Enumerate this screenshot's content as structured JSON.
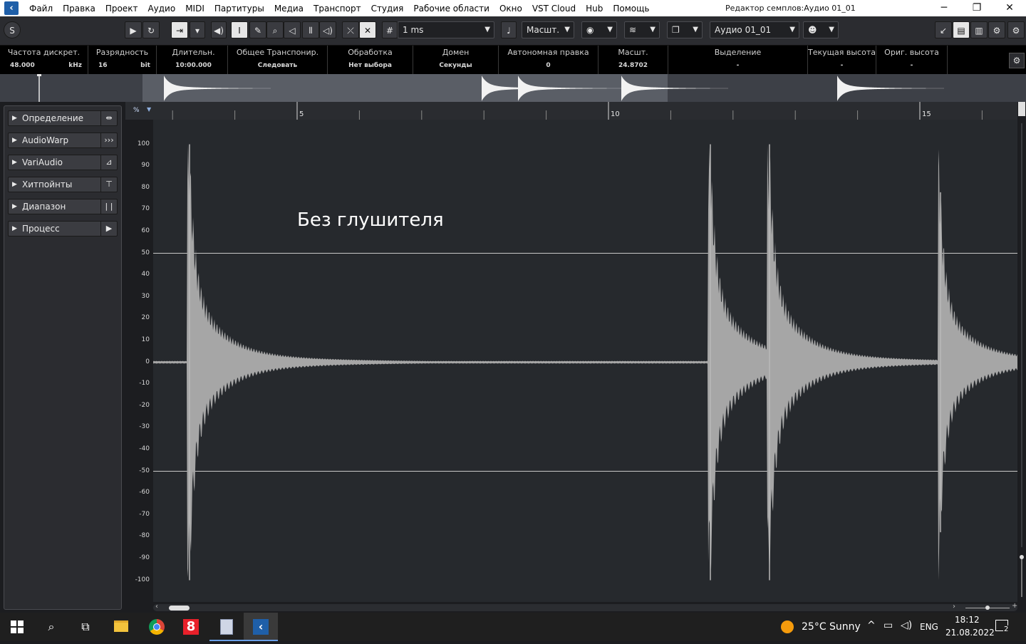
{
  "app": {
    "icon_name": "cubase-logo-icon",
    "window_title": "Редактор семплов:Аудио 01_01"
  },
  "menu": [
    "Файл",
    "Правка",
    "Проект",
    "Аудио",
    "MIDI",
    "Партитуры",
    "Медиа",
    "Транспорт",
    "Студия",
    "Рабочие области",
    "Окно",
    "VST Cloud",
    "Hub",
    "Помощь"
  ],
  "toolbar": {
    "grid_value": "1 ms",
    "zoom_label": "Масшт.",
    "clip_name": "Аудио 01_01"
  },
  "info_line": [
    {
      "label": "Частота дискрет.",
      "value": "48.000",
      "unit": "kHz"
    },
    {
      "label": "Разрядность",
      "value": "16",
      "unit": "bit"
    },
    {
      "label": "Длительн.",
      "value": "10:00.000",
      "unit": ""
    },
    {
      "label": "Общее Транспонир.",
      "value": "Следовать",
      "unit": ""
    },
    {
      "label": "Обработка",
      "value": "Нет выбора",
      "unit": ""
    },
    {
      "label": "Домен",
      "value": "Секунды",
      "unit": ""
    },
    {
      "label": "Автономная правка",
      "value": "0",
      "unit": ""
    },
    {
      "label": "Масшт.",
      "value": "24.8702",
      "unit": ""
    },
    {
      "label": "Выделение",
      "value": "-",
      "unit": ""
    },
    {
      "label": "Текущая высота",
      "value": "-",
      "unit": ""
    },
    {
      "label": "Ориг. высота",
      "value": "-",
      "unit": ""
    }
  ],
  "inspector": {
    "sections": [
      {
        "label": "Определение",
        "icon": "fit-width-icon"
      },
      {
        "label": "AudioWarp",
        "icon": "warp-icon"
      },
      {
        "label": "VariAudio",
        "icon": "variaudio-icon"
      },
      {
        "label": "Хитпойнты",
        "icon": "hitpoint-filter-icon"
      },
      {
        "label": "Диапазон",
        "icon": "range-icon"
      },
      {
        "label": "Процесс",
        "icon": "process-play-icon"
      }
    ]
  },
  "editor": {
    "amplitude_unit": "%",
    "y_ticks": [
      "100",
      "90",
      "80",
      "70",
      "60",
      "50",
      "40",
      "30",
      "20",
      "10",
      "0",
      "-10",
      "-20",
      "-30",
      "-40",
      "-50",
      "-60",
      "-70",
      "-80",
      "-90",
      "-100"
    ],
    "ruler_labels": [
      "5",
      "10",
      "15"
    ],
    "annotation": "Без глушителя"
  },
  "taskbar": {
    "weather_temp": "25°C",
    "weather_text": "Sunny",
    "lang": "ENG",
    "time": "18:12",
    "date": "21.08.2022",
    "notif_count": "2"
  },
  "colors": {
    "accent": "#1f5fa8",
    "waveform": "#a8a8a8",
    "editor_bg": "#26292d"
  }
}
